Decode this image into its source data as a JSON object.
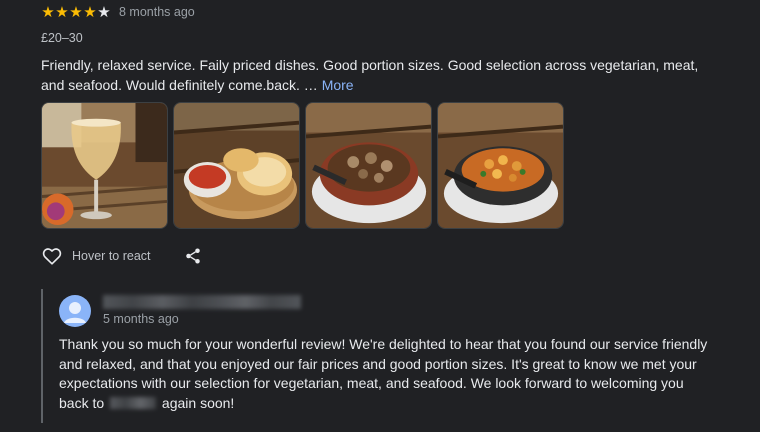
{
  "review": {
    "rating": 4,
    "rating_max": 5,
    "time_ago": "8 months ago",
    "price_range": "£20–30",
    "text": "Friendly, relaxed service. Faily priced dishes. Good portion sizes. Good selection across vegetarian, meat, and seafood. Would definitely come.back. …",
    "more_label": "More",
    "react_label": "Hover to react",
    "colors": {
      "star": "#fbbc04",
      "link": "#8ab4f8",
      "background": "#202124"
    }
  },
  "reply": {
    "time_ago": "5 months ago",
    "text_before_redaction": "Thank you so much for your wonderful review! We're delighted to hear that you found our service friendly and relaxed, and that you enjoyed our fair prices and good portion sizes. It's great to know we met your expectations with our selection for vegetarian, meat, and seafood. We look forward to welcoming you back to",
    "text_after_redaction": "again soon!"
  },
  "icons": {
    "star": "star-icon",
    "like": "heart-icon",
    "share": "share-icon",
    "avatar": "person-icon"
  }
}
